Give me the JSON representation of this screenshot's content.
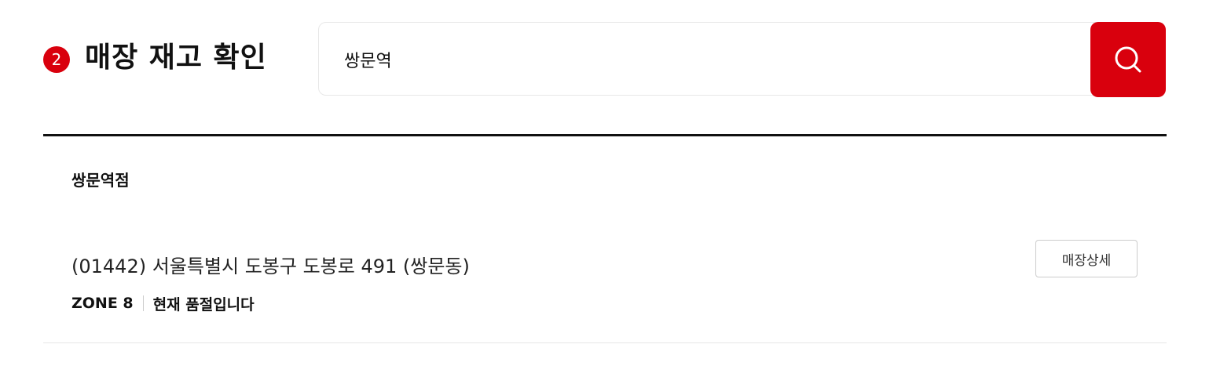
{
  "section": {
    "step_number": "2",
    "title": "매장 재고 확인"
  },
  "search": {
    "value": "쌍문역",
    "icon": "search-icon"
  },
  "store": {
    "name": "쌍문역점",
    "address": "(01442) 서울특별시 도봉구 도봉로 491 (쌍문동)",
    "detail_button_label": "매장상세",
    "zone": "ZONE 8",
    "stock_status": "현재 품절입니다"
  },
  "colors": {
    "accent": "#d9000d",
    "text": "#111111",
    "divider": "#111111"
  }
}
